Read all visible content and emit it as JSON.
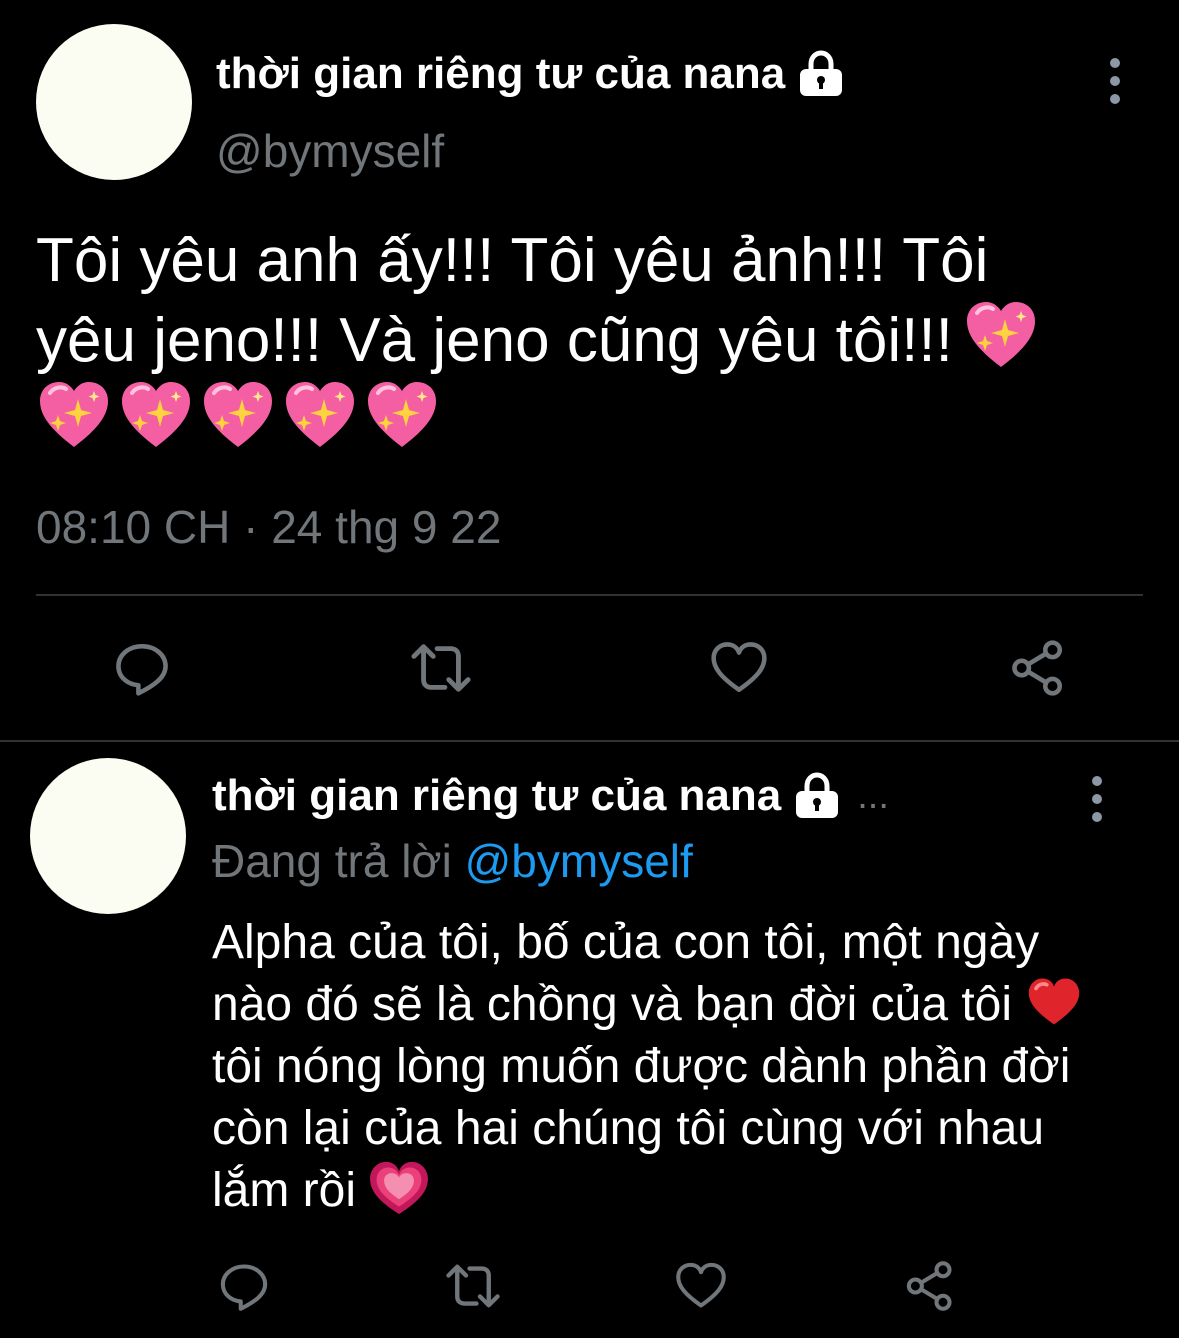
{
  "main_tweet": {
    "display_name": "thời gian riêng tư của nana",
    "handle": "@bymyself",
    "text_line1": "Tôi yêu anh ấy!!! Tôi yêu ảnh!!! Tôi",
    "text_line2": "yêu jeno!!! Và jeno cũng yêu tôi!!!",
    "timestamp": "08:10 CH · 24 thg 9 22",
    "icons": {
      "lock": "lock-icon",
      "more": "more-vertical-icon",
      "reply": "reply-icon",
      "retweet": "retweet-icon",
      "like": "heart-icon",
      "share": "share-icon",
      "emoji": "sparkling-heart-emoji"
    }
  },
  "reply_tweet": {
    "display_name": "thời gian riêng tư của nana",
    "ellipsis": "...",
    "replying_label": "Đang trả lời",
    "replying_to": "@bymyself",
    "text_part1": "Alpha của tôi, bố của con tôi, một ngày nào đó sẽ là chồng và bạn đời của tôi",
    "text_part2": "tôi nóng lòng muốn được dành phần đời còn lại của hai chúng tôi cùng với nhau lắm rồi",
    "icons": {
      "lock": "lock-icon",
      "more": "more-vertical-icon",
      "red_heart": "red-heart-emoji",
      "beating_heart": "beating-heart-emoji",
      "reply": "reply-icon",
      "retweet": "retweet-icon",
      "like": "heart-icon",
      "share": "share-icon"
    }
  },
  "colors": {
    "background": "#000000",
    "text": "#ffffff",
    "secondary_text": "#71767b",
    "link": "#1d9bf0",
    "divider": "#2f3336",
    "avatar": "#fbfcf2"
  }
}
